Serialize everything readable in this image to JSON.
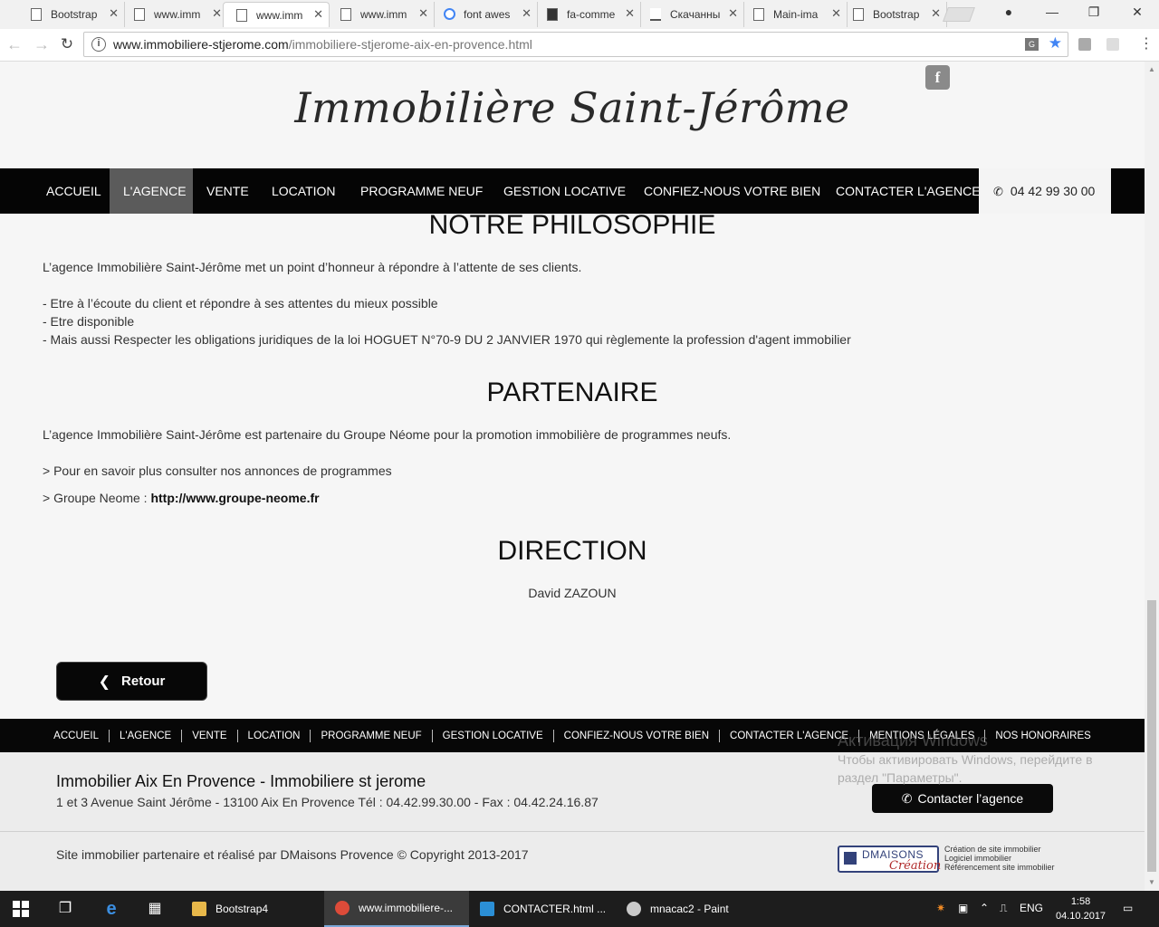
{
  "browser": {
    "tabs": [
      {
        "label": "Bootstrap",
        "icon": "page-icon"
      },
      {
        "label": "www.imm",
        "icon": "page-icon"
      },
      {
        "label": "www.imm",
        "icon": "page-icon",
        "active": true
      },
      {
        "label": "www.imm",
        "icon": "page-icon"
      },
      {
        "label": "font awes",
        "icon": "google-icon"
      },
      {
        "label": "fa-comme",
        "icon": "image-icon"
      },
      {
        "label": "Скачанны",
        "icon": "download-icon"
      },
      {
        "label": "Main-ima",
        "icon": "page-icon"
      },
      {
        "label": "Bootstrap",
        "icon": "page-icon"
      }
    ],
    "url_host": "www.immobiliere-stjerome.com",
    "url_path": "/immobiliere-stjerome-aix-en-provence.html"
  },
  "site": {
    "logo": "Immobilière Saint-Jérôme",
    "facebook_label": "f",
    "nav": [
      {
        "label": "ACCUEIL"
      },
      {
        "label": "L'AGENCE",
        "active": true
      },
      {
        "label": "VENTE"
      },
      {
        "label": "LOCATION"
      },
      {
        "label": "PROGRAMME NEUF"
      },
      {
        "label": "GESTION LOCATIVE"
      },
      {
        "label": "CONFIEZ-NOUS VOTRE BIEN"
      },
      {
        "label": "CONTACTER L'AGENCE"
      }
    ],
    "phone": "04 42 99 30 00"
  },
  "content": {
    "philosophy": {
      "title": "NOTRE PHILOSOPHIE",
      "intro": "L’agence Immobilière Saint-Jérôme met un point d’honneur à répondre à l’attente de ses clients.",
      "items": [
        "- Etre à l’écoute du client et répondre à ses attentes du mieux possible",
        "- Etre disponible",
        "- Mais aussi Respecter les obligations juridiques de la loi HOGUET N°70-9 DU 2 JANVIER 1970 qui règlemente la profession d'agent immobilier"
      ]
    },
    "partner": {
      "title": "PARTENAIRE",
      "intro": "L’agence Immobilière Saint-Jérôme est partenaire du Groupe Néome pour la promotion immobilière de programmes neufs.",
      "line1": "> Pour en savoir plus consulter nos annonces de programmes",
      "line2_prefix": "> Groupe Neome : ",
      "line2_link": "http://www.groupe-neome.fr"
    },
    "direction": {
      "title": "DIRECTION",
      "name": "David ZAZOUN"
    },
    "back_label": "Retour"
  },
  "footer": {
    "nav": [
      "ACCUEIL",
      "L'AGENCE",
      "VENTE",
      "LOCATION",
      "PROGRAMME NEUF",
      "GESTION LOCATIVE",
      "CONFIEZ-NOUS VOTRE BIEN",
      "CONTACTER L'AGENCE",
      "MENTIONS LÉGALES",
      "NOS HONORAIRES"
    ],
    "title": "Immobilier Aix En Provence - Immobiliere st jerome",
    "address": "1 et 3 Avenue Saint Jérôme - 13100 Aix En Provence Tél : 04.42.99.30.00 - Fax : 04.42.24.16.87",
    "contact_label": "Contacter l’agence",
    "copyright": "Site immobilier partenaire et réalisé par DMaisons Provence © Copyright 2013-2017",
    "dm_logo_top": "DMAISONS",
    "dm_logo_bottom": "Création",
    "dm_lines": [
      "Création de site immobilier",
      "Logiciel immobilier",
      "Référencement site immobilier"
    ]
  },
  "watermark": {
    "line1": "Активация Windows",
    "line2": "Чтобы активировать Windows, перейдите в раздел \"Параметры\"."
  },
  "taskbar": {
    "items": [
      {
        "label": "Bootstrap4",
        "color": "#e8b84a"
      },
      {
        "label": "www.immobiliere-...",
        "color": "#dd4b39",
        "active": true
      },
      {
        "label": "CONTACTER.html ...",
        "color": "#2b8fd6"
      },
      {
        "label": "mnacac2 - Paint",
        "color": "#c9c9c9"
      }
    ],
    "lang": "ENG",
    "time": "1:58",
    "date": "04.10.2017"
  }
}
